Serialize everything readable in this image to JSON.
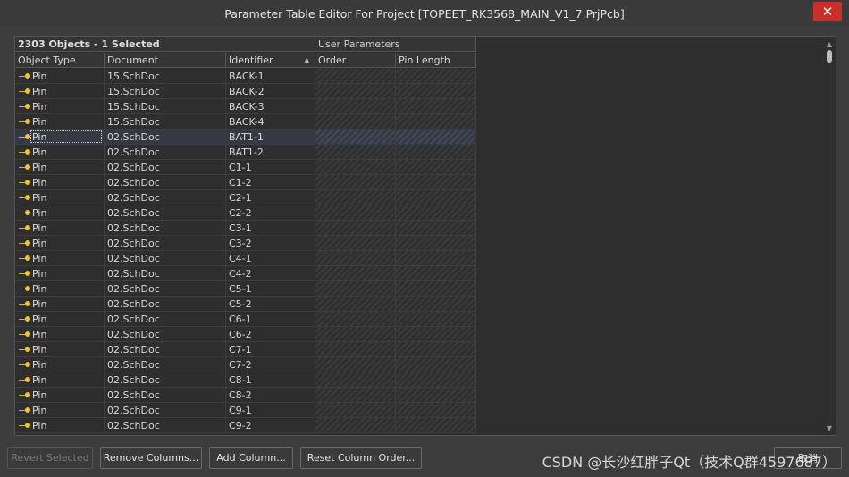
{
  "window": {
    "title": "Parameter Table Editor For Project [TOPEET_RK3568_MAIN_V1_7.PrjPcb]",
    "close_icon": "close-icon"
  },
  "grid": {
    "group_label": "2303 Objects - 1 Selected",
    "user_parameters_label": "User Parameters",
    "columns": [
      "Object Type",
      "Document",
      "Identifier",
      "Order",
      "Pin Length"
    ],
    "rows": [
      {
        "type": "Pin",
        "document": "15.SchDoc",
        "identifier": "BACK-1"
      },
      {
        "type": "Pin",
        "document": "15.SchDoc",
        "identifier": "BACK-2"
      },
      {
        "type": "Pin",
        "document": "15.SchDoc",
        "identifier": "BACK-3"
      },
      {
        "type": "Pin",
        "document": "15.SchDoc",
        "identifier": "BACK-4"
      },
      {
        "type": "Pin",
        "document": "02.SchDoc",
        "identifier": "BAT1-1"
      },
      {
        "type": "Pin",
        "document": "02.SchDoc",
        "identifier": "BAT1-2"
      },
      {
        "type": "Pin",
        "document": "02.SchDoc",
        "identifier": "C1-1"
      },
      {
        "type": "Pin",
        "document": "02.SchDoc",
        "identifier": "C1-2"
      },
      {
        "type": "Pin",
        "document": "02.SchDoc",
        "identifier": "C2-1"
      },
      {
        "type": "Pin",
        "document": "02.SchDoc",
        "identifier": "C2-2"
      },
      {
        "type": "Pin",
        "document": "02.SchDoc",
        "identifier": "C3-1"
      },
      {
        "type": "Pin",
        "document": "02.SchDoc",
        "identifier": "C3-2"
      },
      {
        "type": "Pin",
        "document": "02.SchDoc",
        "identifier": "C4-1"
      },
      {
        "type": "Pin",
        "document": "02.SchDoc",
        "identifier": "C4-2"
      },
      {
        "type": "Pin",
        "document": "02.SchDoc",
        "identifier": "C5-1"
      },
      {
        "type": "Pin",
        "document": "02.SchDoc",
        "identifier": "C5-2"
      },
      {
        "type": "Pin",
        "document": "02.SchDoc",
        "identifier": "C6-1"
      },
      {
        "type": "Pin",
        "document": "02.SchDoc",
        "identifier": "C6-2"
      },
      {
        "type": "Pin",
        "document": "02.SchDoc",
        "identifier": "C7-1"
      },
      {
        "type": "Pin",
        "document": "02.SchDoc",
        "identifier": "C7-2"
      },
      {
        "type": "Pin",
        "document": "02.SchDoc",
        "identifier": "C8-1"
      },
      {
        "type": "Pin",
        "document": "02.SchDoc",
        "identifier": "C8-2"
      },
      {
        "type": "Pin",
        "document": "02.SchDoc",
        "identifier": "C9-1"
      },
      {
        "type": "Pin",
        "document": "02.SchDoc",
        "identifier": "C9-2"
      }
    ],
    "selected_row": 4,
    "sort_icon": "sort-ascending-icon",
    "row_icon": "pin-icon"
  },
  "buttons": {
    "revert_selected": "Revert Selected",
    "remove_columns": "Remove Columns...",
    "add_column": "Add Column...",
    "reset_column_order": "Reset Column Order...",
    "cancel": "取消"
  },
  "watermark": "CSDN @长沙红胖子Qt（技术Q群4597687）",
  "colors": {
    "background": "#3c3c3c",
    "grid_background": "#2e2e2e",
    "close_button": "#c9302c",
    "pin_icon": "#f2c13a",
    "selected_row": "#353a42"
  }
}
